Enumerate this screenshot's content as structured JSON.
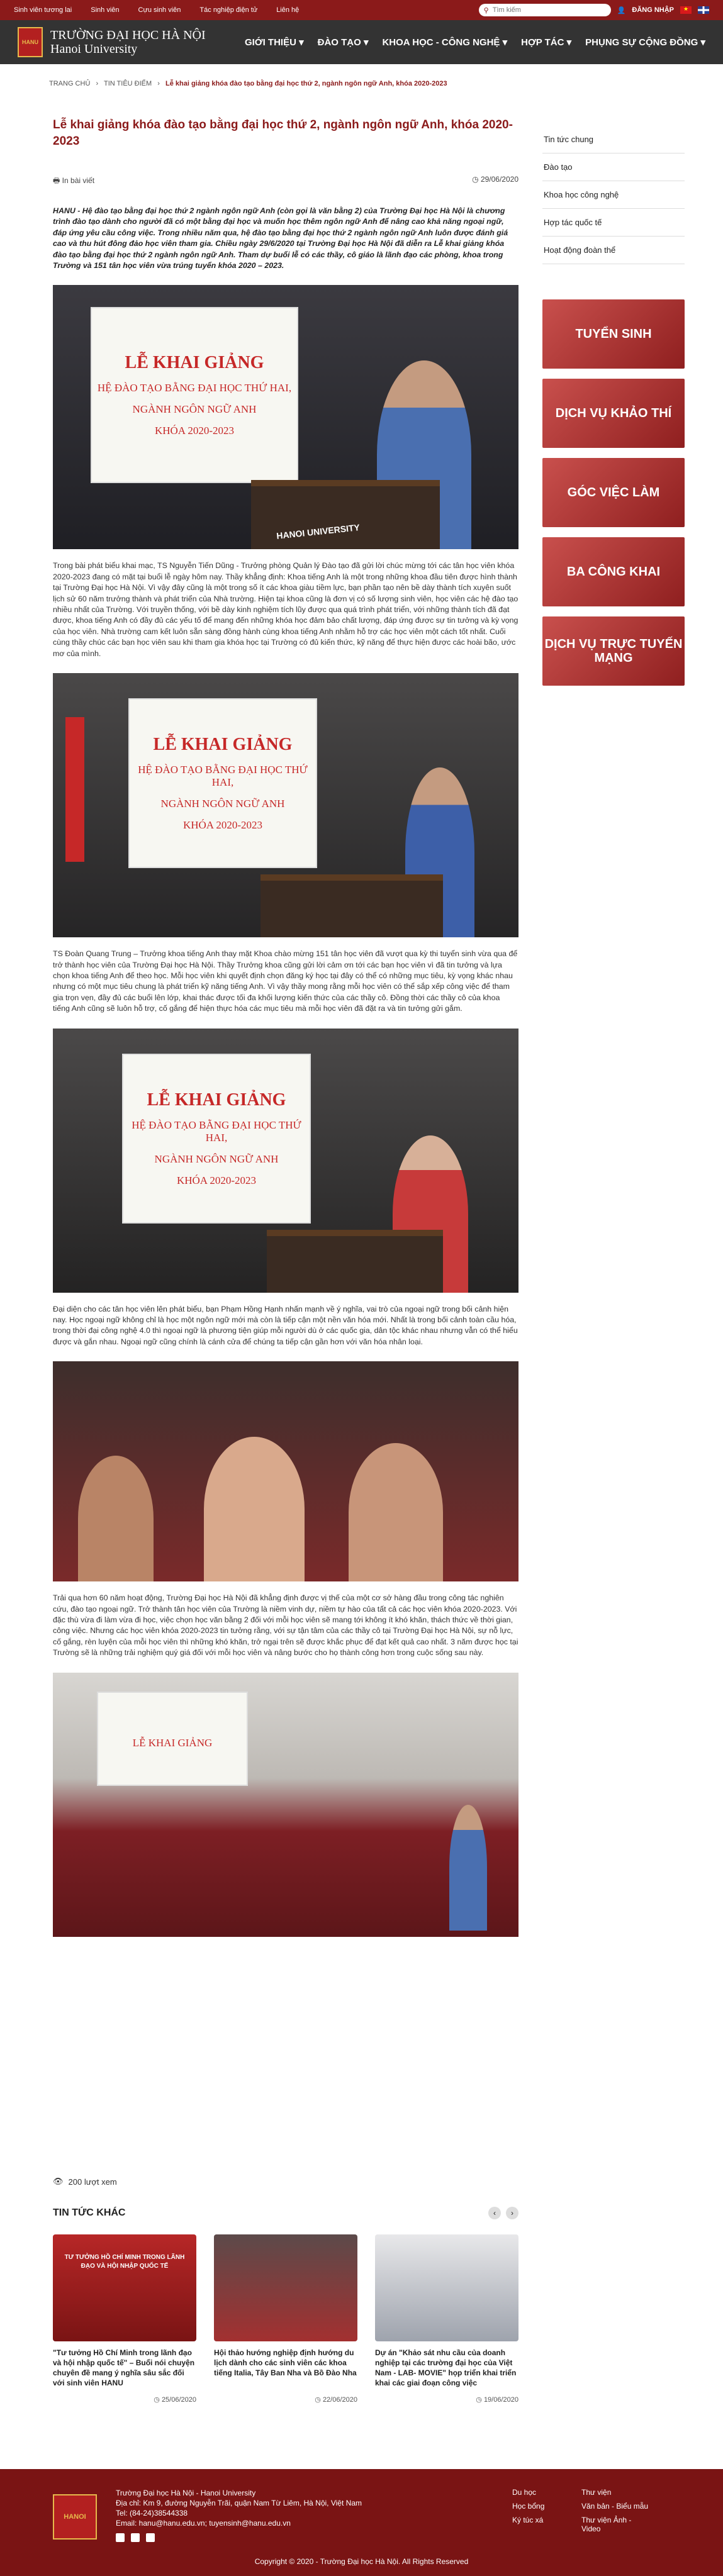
{
  "topbar": {
    "links": [
      "Sinh viên tương lai",
      "Sinh viên",
      "Cựu sinh viên",
      "Tác nghiệp điện tử",
      "Liên hệ"
    ],
    "search_placeholder": "Tìm kiếm",
    "login": "ĐĂNG NHẬP"
  },
  "header": {
    "logo_line1": "TRƯỜNG ĐẠI HỌC HÀ NỘI",
    "logo_line2": "Hanoi University",
    "logo_mark": "HANU",
    "nav": [
      "GIỚI THIỆU ▾",
      "ĐÀO TẠO ▾",
      "KHOA HỌC - CÔNG NGHỆ ▾",
      "HỢP TÁC ▾",
      "PHỤNG SỰ CỘNG ĐỒNG ▾"
    ]
  },
  "breadcrumb": [
    "TRANG CHỦ",
    "›",
    "TIN TIÊU ĐIỂM",
    "›",
    "Lễ khai giảng khóa đào tạo bằng đại học thứ 2, ngành ngôn ngữ Anh, khóa 2020-2023"
  ],
  "article": {
    "title": "Lễ khai giảng khóa đào tạo bằng đại học thứ 2, ngành ngôn ngữ Anh, khóa 2020-2023",
    "category": "In bài viết",
    "date": "29/06/2020",
    "sapo": "HANU - Hệ đào tạo bằng đại học thứ 2 ngành ngôn ngữ Anh (còn gọi là văn bằng 2) của Trường Đại học Hà Nội là chương trình đào tạo dành cho người đã có một bằng đại học và muốn học thêm ngôn ngữ Anh để nâng cao khả năng ngoại ngữ, đáp ứng yêu cầu công việc. Trong nhiều năm qua, hệ đào tạo bằng đại học thứ 2 ngành ngôn ngữ Anh luôn được đánh giá cao và thu hút đông đảo học viên tham gia. Chiều ngày 29/6/2020 tại Trường Đại học Hà Nội đã diễn ra Lễ khai giảng khóa đào tạo bằng đại học thứ 2 ngành ngôn ngữ Anh. Tham dự buổi lễ có các thầy, cô giáo là lãnh đạo các phòng, khoa trong Trường và 151 tân học viên vừa trúng tuyển khóa 2020 – 2023.",
    "screen": {
      "line1": "LỄ KHAI GIẢNG",
      "line2": "HỆ ĐÀO TẠO BẰNG ĐẠI HỌC THỨ HAI,",
      "line3": "NGÀNH NGÔN NGỮ ANH",
      "line4": "KHÓA 2020-2023"
    },
    "podium_text": "HANOI UNIVERSITY",
    "para1": "Trong bài phát biểu khai mạc, TS Nguyễn Tiến Dũng - Trưởng phòng Quản lý Đào tạo đã gửi lời chúc mừng tới các tân học viên khóa 2020-2023 đang có mặt tại buổi lễ ngày hôm nay. Thầy khẳng định: Khoa tiếng Anh là một trong những khoa đầu tiên được hình thành tại Trường Đại học Hà Nội. Vì vậy đây cũng là một trong số ít các khoa giàu tiềm lực, bạn phần tạo nên bề dày thành tích xuyên suốt lịch sử 60 năm trưởng thành và phát triển của Nhà trường. Hiện tại khoa cũng là đơn vị có số lượng sinh viên, học viên các hệ đào tạo nhiều nhất của Trường. Với truyền thống, với bề dày kinh nghiệm tích lũy được qua quá trình phát triển, với những thành tích đã đạt được, khoa tiếng Anh có đầy đủ các yếu tố để mang đến những khóa học đảm bảo chất lượng, đáp ứng được sự tin tưởng và kỳ vọng của học viên. Nhà trường cam kết luôn sẵn sàng đồng hành cùng khoa tiếng Anh nhằm hỗ trợ các học viên một cách tốt nhất. Cuối cùng thầy chúc các bạn học viên sau khi tham gia khóa học tại Trường có đủ kiến thức, kỹ năng để thực hiện được các hoài bão, ước mơ của mình.",
    "para2": "TS Đoàn Quang Trung – Trưởng khoa tiếng Anh thay mặt Khoa chào mừng 151 tân học viên đã vượt qua kỳ thi tuyển sinh vừa qua để trở thành học viên của Trường Đại học Hà Nội. Thầy Trưởng khoa cũng gửi lời cảm ơn tới các bạn học viên vì đã tin tưởng và lựa chọn khoa tiếng Anh để theo học. Mỗi học viên khi quyết định chọn đăng ký học tại đây có thể có những mục tiêu, kỳ vọng khác nhau nhưng có một mục tiêu chung là phát triển kỹ năng tiếng Anh. Vì vậy thầy mong rằng mỗi học viên có thể sắp xếp công việc để tham gia trọn vẹn, đầy đủ các buổi lên lớp, khai thác được tối đa khối lượng kiến thức của các thầy cô. Đồng thời các thầy cô của khoa tiếng Anh cũng sẽ luôn hỗ trợ, cố gắng để hiện thực hóa các mục tiêu mà mỗi học viên đã đặt ra và tin tưởng gửi gắm.",
    "para3": "Đại diện cho các tân học viên lên phát biểu, bạn Phạm Hồng Hạnh nhấn mạnh về ý nghĩa, vai trò của ngoại ngữ trong bối cảnh hiện nay. Học ngoại ngữ không chỉ là học một ngôn ngữ mới mà còn là tiếp cận một nền văn hóa mới. Nhất là trong bối cảnh toàn cầu hóa, trong thời đại công nghệ 4.0 thì ngoại ngữ là phương tiện giúp mỗi người dù ở các quốc gia, dân tộc khác nhau nhưng vẫn có thể hiểu được và gắn nhau. Ngoại ngữ cũng chính là cánh cửa để chúng ta tiếp cận gần hơn với văn hóa nhân loại.",
    "para4": "Trải qua hơn 60 năm hoạt động, Trường Đại học Hà Nội đã khẳng định được vị thế của một cơ sở hàng đầu trong công tác nghiên cứu, đào tạo ngoại ngữ. Trở thành tân học viên của Trường là niềm vinh dự, niềm tự hào của tất cả các học viên khóa 2020-2023. Với đặc thù vừa đi làm vừa đi học, việc chọn học văn bằng 2 đối với mỗi học viên sẽ mang tới không ít khó khăn, thách thức về thời gian, công việc. Nhưng các học viên khóa 2020-2023 tin tưởng rằng, với sự tận tâm của các thầy cô tại Trường Đại học Hà Nội, sự nỗ lực, cố gắng, rèn luyện của mỗi học viên thì những khó khăn, trở ngại trên sẽ được khắc phục để đạt kết quả cao nhất. 3 năm được học tại Trường sẽ là những trải nghiệm quý giá đối với mỗi học viên và nâng bước cho họ thành công hơn trong cuộc sống sau này.",
    "views": "200 lượt xem"
  },
  "related": {
    "heading": "TIN TỨC KHÁC",
    "prev": "‹",
    "next": "›",
    "items": [
      {
        "title": "\"Tư tưởng Hồ Chí Minh trong lãnh đạo và hội nhập quốc tế\" – Buổi nói chuyện chuyên đề mang ý nghĩa sâu sắc đối với sinh viên HANU",
        "date": "25/06/2020",
        "img_text": "TƯ TƯỞNG HỒ CHÍ MINH TRONG LÃNH ĐẠO VÀ HỘI NHẬP QUỐC TẾ"
      },
      {
        "title": "Hội thảo hướng nghiệp định hướng du lịch dành cho các sinh viên các khoa tiếng Italia, Tây Ban Nha và Bồ Đào Nha",
        "date": "22/06/2020"
      },
      {
        "title": "Dự án \"Khảo sát nhu cầu của doanh nghiệp tại các trường đại học của Việt Nam - LAB- MOVIE\" họp triển khai triển khai các giai đoạn công việc",
        "date": "19/06/2020"
      }
    ]
  },
  "sidebar": {
    "menu": [
      "Tin tức chung",
      "Đào tạo",
      "Khoa học công nghệ",
      "Hợp tác quốc tế",
      "Hoạt động đoàn thể"
    ],
    "banners": [
      "TUYỂN SINH",
      "DỊCH VỤ KHẢO THÍ",
      "GÓC VIỆC LÀM",
      "BA CÔNG KHAI",
      "DỊCH VỤ TRỰC TUYẾN MẠNG"
    ]
  },
  "footer": {
    "logo_mark": "HANOI",
    "name": "Trường Đại học Hà Nội - Hanoi University",
    "address": "Địa chỉ: Km 9, đường Nguyễn Trãi, quận Nam Từ Liêm, Hà Nội, Việt Nam",
    "tel": "Tel: (84-24)38544338",
    "email": "Email: hanu@hanu.edu.vn; tuyensinh@hanu.edu.vn",
    "links": [
      "Du học",
      "Thư viện",
      "Học bổng",
      "Văn bản - Biểu mẫu",
      "Ký túc xá",
      "Thư viện Ảnh - Video"
    ],
    "copyright": "Copyright © 2020 - Trường Đại học Hà Nội. All Rights Reserved"
  },
  "colors": {
    "brand": "#8b1a1a",
    "header": "#333333"
  }
}
